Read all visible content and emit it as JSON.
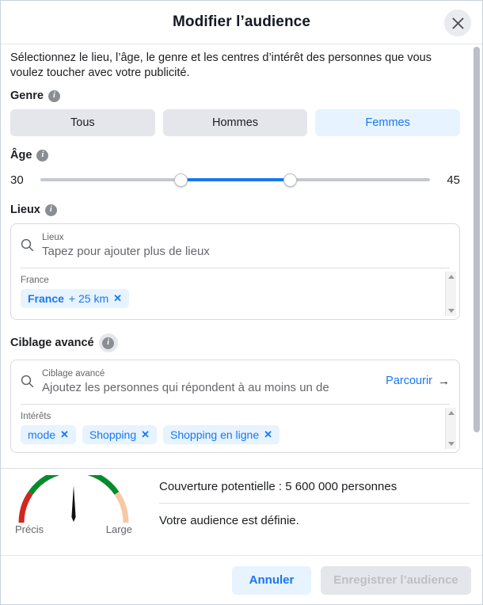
{
  "dialog": {
    "title": "Modifier l’audience",
    "close_icon": "close-icon",
    "intro": "Sélectionnez le lieu, l’âge, le genre et les centres d’intérêt des personnes que vous voulez toucher avec votre publicité."
  },
  "gender": {
    "label": "Genre",
    "info_icon": "info-icon",
    "options": [
      {
        "label": "Tous",
        "selected": false
      },
      {
        "label": "Hommes",
        "selected": false
      },
      {
        "label": "Femmes",
        "selected": true
      }
    ],
    "selected": "Femmes"
  },
  "age": {
    "label": "Âge",
    "info_icon": "info-icon",
    "min": "30",
    "max": "45"
  },
  "locations": {
    "label": "Lieux",
    "info_icon": "info-icon",
    "search_icon": "search-icon",
    "field_label": "Lieux",
    "placeholder": "Tapez pour ajouter plus de lieux",
    "category": "France",
    "chips": [
      {
        "name": "France",
        "radius": "+ 25 km",
        "remove_icon": "close-icon"
      }
    ],
    "scrollbar_up_icon": "triangle-up-icon",
    "scrollbar_down_icon": "triangle-down-icon"
  },
  "advanced": {
    "label": "Ciblage avancé",
    "info_icon": "info-icon",
    "search_icon": "search-icon",
    "field_label": "Ciblage avancé",
    "placeholder": "Ajoutez les personnes qui répondent à au moins un de",
    "browse_label": "Parcourir",
    "browse_arrow_icon": "arrow-right-icon",
    "category": "Intérêts",
    "chips": [
      {
        "name": "mode",
        "remove_icon": "close-icon"
      },
      {
        "name": "Shopping",
        "remove_icon": "close-icon"
      },
      {
        "name": "Shopping en ligne",
        "remove_icon": "close-icon"
      }
    ],
    "scrollbar_up_icon": "triangle-up-icon",
    "scrollbar_down_icon": "triangle-down-icon"
  },
  "summary": {
    "gauge": {
      "icon": "gauge-meter",
      "left_label": "Précis",
      "right_label": "Large",
      "needle_position_pct": 50,
      "colors": {
        "precise": "#d3261e",
        "good": "#078a2d",
        "broad": "#f7c8a4"
      }
    },
    "reach_text": "Couverture potentielle : 5 600 000 personnes",
    "status_text": "Votre audience est définie."
  },
  "footer": {
    "cancel_label": "Annuler",
    "save_label": "Enregistrer l’audience",
    "save_disabled": true
  },
  "colors": {
    "accent": "#1877f2",
    "accent_bg": "#e7f3ff",
    "neutral_bg": "#e4e6eb",
    "text": "#1c1e21",
    "muted": "#65676b"
  }
}
